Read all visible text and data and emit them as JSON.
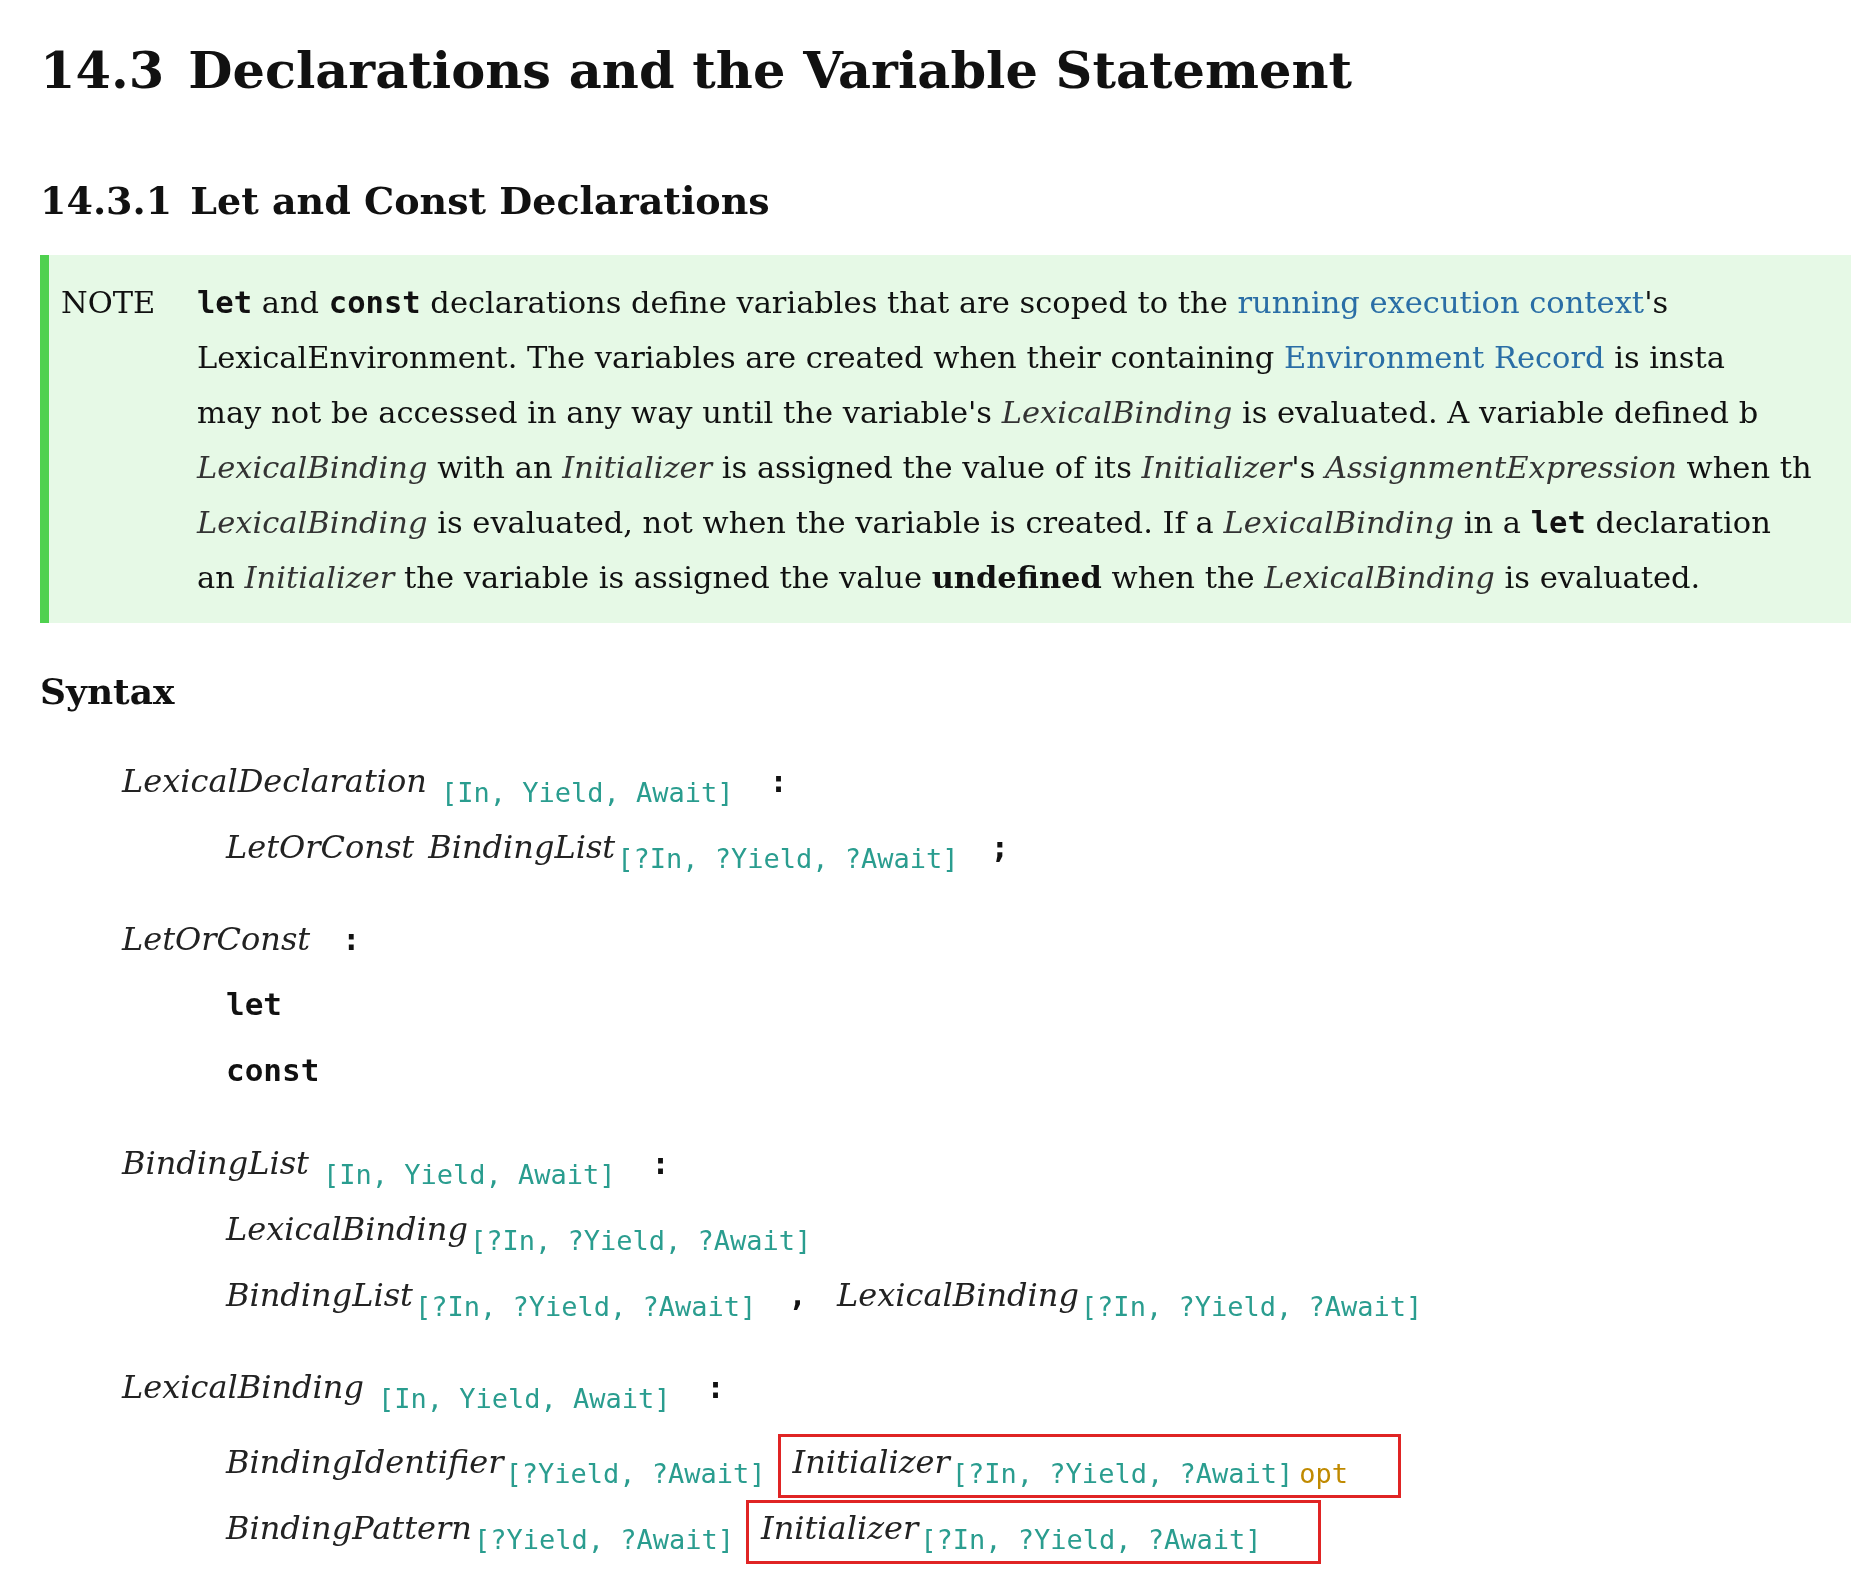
{
  "heading": {
    "number": "14.3",
    "title": "Declarations and the Variable Statement"
  },
  "subheading": {
    "number": "14.3.1",
    "title": "Let and Const Declarations"
  },
  "note": {
    "label": "NOTE",
    "lines": [
      [
        {
          "kind": "code",
          "text": "let"
        },
        {
          "kind": "text",
          "text": " and "
        },
        {
          "kind": "code",
          "text": "const"
        },
        {
          "kind": "text",
          "text": " declarations define variables that are scoped to the "
        },
        {
          "kind": "link",
          "text": "running execution context"
        },
        {
          "kind": "text",
          "text": "'s"
        }
      ],
      [
        {
          "kind": "text",
          "text": "LexicalEnvironment. The variables are created when their containing "
        },
        {
          "kind": "link",
          "text": "Environment Record"
        },
        {
          "kind": "text",
          "text": " is insta"
        }
      ],
      [
        {
          "kind": "text",
          "text": "may not be accessed in any way until the variable's "
        },
        {
          "kind": "italic",
          "text": "LexicalBinding"
        },
        {
          "kind": "text",
          "text": " is evaluated. A variable defined b"
        }
      ],
      [
        {
          "kind": "italic",
          "text": "LexicalBinding"
        },
        {
          "kind": "text",
          "text": " with an "
        },
        {
          "kind": "italic",
          "text": "Initializer"
        },
        {
          "kind": "text",
          "text": " is assigned the value of its "
        },
        {
          "kind": "italic",
          "text": "Initializer"
        },
        {
          "kind": "text",
          "text": "'s "
        },
        {
          "kind": "italic",
          "text": "AssignmentExpression"
        },
        {
          "kind": "text",
          "text": " when th"
        }
      ],
      [
        {
          "kind": "italic",
          "text": "LexicalBinding"
        },
        {
          "kind": "text",
          "text": " is evaluated, not when the variable is created. If a "
        },
        {
          "kind": "italic",
          "text": "LexicalBinding"
        },
        {
          "kind": "text",
          "text": " in a "
        },
        {
          "kind": "code",
          "text": "let"
        },
        {
          "kind": "text",
          "text": " declaration"
        }
      ],
      [
        {
          "kind": "text",
          "text": "an "
        },
        {
          "kind": "italic",
          "text": "Initializer"
        },
        {
          "kind": "text",
          "text": " the variable is assigned the value "
        },
        {
          "kind": "bold",
          "text": "undefined"
        },
        {
          "kind": "text",
          "text": " when the "
        },
        {
          "kind": "italic",
          "text": "LexicalBinding"
        },
        {
          "kind": "text",
          "text": " is evaluated."
        }
      ]
    ]
  },
  "syntax_heading": "Syntax",
  "productions": [
    {
      "name": "LexicalDeclaration",
      "params": "[In, Yield, Await]",
      "separator": ":",
      "alternatives": [
        [
          {
            "kind": "nonterminal",
            "name": "LetOrConst",
            "boxed": false
          },
          {
            "kind": "nonterminal",
            "name": "BindingList",
            "params": "[?In, ?Yield, ?Await]",
            "boxed": false
          },
          {
            "kind": "terminal",
            "text": ";"
          }
        ]
      ]
    },
    {
      "name": "LetOrConst",
      "separator": ":",
      "alternatives": [
        [
          {
            "kind": "terminal",
            "text": "let"
          }
        ],
        [
          {
            "kind": "terminal",
            "text": "const"
          }
        ]
      ]
    },
    {
      "name": "BindingList",
      "params": "[In, Yield, Await]",
      "separator": ":",
      "alternatives": [
        [
          {
            "kind": "nonterminal",
            "name": "LexicalBinding",
            "params": "[?In, ?Yield, ?Await]",
            "boxed": false
          }
        ],
        [
          {
            "kind": "nonterminal",
            "name": "BindingList",
            "params": "[?In, ?Yield, ?Await]",
            "boxed": false
          },
          {
            "kind": "terminal",
            "text": ","
          },
          {
            "kind": "nonterminal",
            "name": "LexicalBinding",
            "params": "[?In, ?Yield, ?Await]",
            "boxed": false
          }
        ]
      ]
    },
    {
      "name": "LexicalBinding",
      "params": "[In, Yield, Await]",
      "separator": ":",
      "alternatives": [
        [
          {
            "kind": "nonterminal",
            "name": "BindingIdentifier",
            "params": "[?Yield, ?Await]",
            "boxed": false
          },
          {
            "kind": "nonterminal",
            "name": "Initializer",
            "params": "[?In, ?Yield, ?Await]",
            "suffix": "opt",
            "boxed": true
          }
        ],
        [
          {
            "kind": "nonterminal",
            "name": "BindingPattern",
            "params": "[?Yield, ?Await]",
            "boxed": false
          },
          {
            "kind": "nonterminal",
            "name": "Initializer",
            "params": "[?In, ?Yield, ?Await]",
            "boxed": true
          }
        ]
      ]
    }
  ]
}
